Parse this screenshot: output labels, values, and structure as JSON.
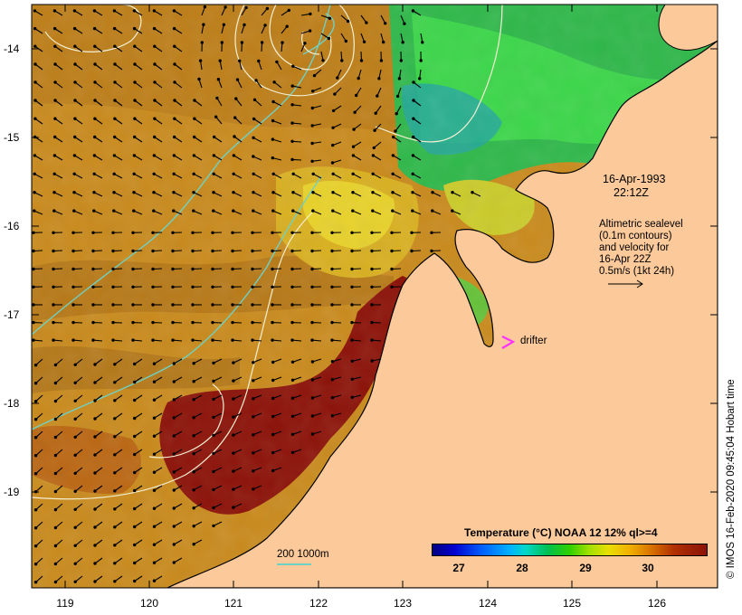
{
  "map": {
    "lat_labels": [
      "-14",
      "-15",
      "-16",
      "-17",
      "-18",
      "-19"
    ],
    "lon_labels": [
      "119",
      "120",
      "121",
      "122",
      "123",
      "124",
      "125",
      "126"
    ],
    "colors": {
      "land": "#fbc99a",
      "ocean_base": "#c98a1c",
      "warm_inshore": "#8c1208",
      "contour": "#f4f0d4",
      "isobath": "#6fd1c4",
      "drifter": "#ff33ff",
      "coast": "#000000"
    }
  },
  "annotation": {
    "date": "16-Apr-1993",
    "time": "22:12Z",
    "legend_lines": [
      "Altimetric sealevel",
      "(0.1m contours)",
      "and velocity for",
      "16-Apr 22Z",
      "0.5m/s (1kt 24h)"
    ],
    "drifter_label": "drifter"
  },
  "scale": {
    "label": "200  1000m"
  },
  "colorbar": {
    "title": "Temperature (°C) NOAA 12 12% ql>=4",
    "ticks": [
      "27",
      "28",
      "29",
      "30"
    ]
  },
  "credit": "© IMOS 16-Feb-2020 09:45:04 Hobart time"
}
